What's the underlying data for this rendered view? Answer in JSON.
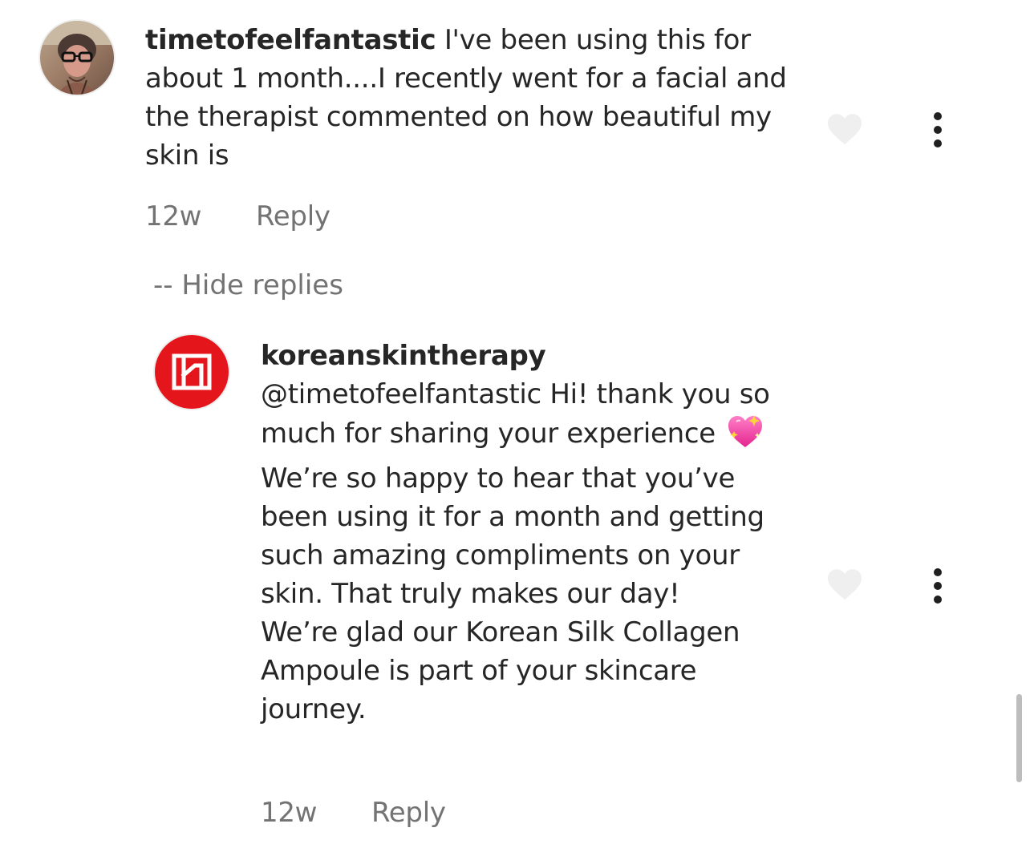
{
  "comment": {
    "username": "timetofeelfantastic",
    "text": " I've been using this for about 1 month....I recently went for a facial and the therapist commented on how beautiful my skin is",
    "time": "12w",
    "reply_label": "Reply"
  },
  "hide_replies_label": "-- Hide replies",
  "reply": {
    "username": "koreanskintherapy",
    "text_before_emoji": "@timetofeelfantastic Hi! thank you so much for sharing your experience",
    "emoji": "sparkling-heart",
    "text_after_emoji": " We’re so happy to hear that you’ve been using it for a month and getting such amazing compliments on your skin. That truly makes our day!",
    "text_second_paragraph": "We’re glad our Korean Silk Collagen Ampoule is part of your skincare journey.",
    "time": "12w",
    "reply_label": "Reply"
  },
  "colors": {
    "brand_red": "#e5161b",
    "meta_gray": "#737373",
    "text": "#262626",
    "heart_outline": "#efefef"
  },
  "icons": {
    "like": "heart-outline-icon",
    "more": "vertical-ellipsis-icon"
  }
}
